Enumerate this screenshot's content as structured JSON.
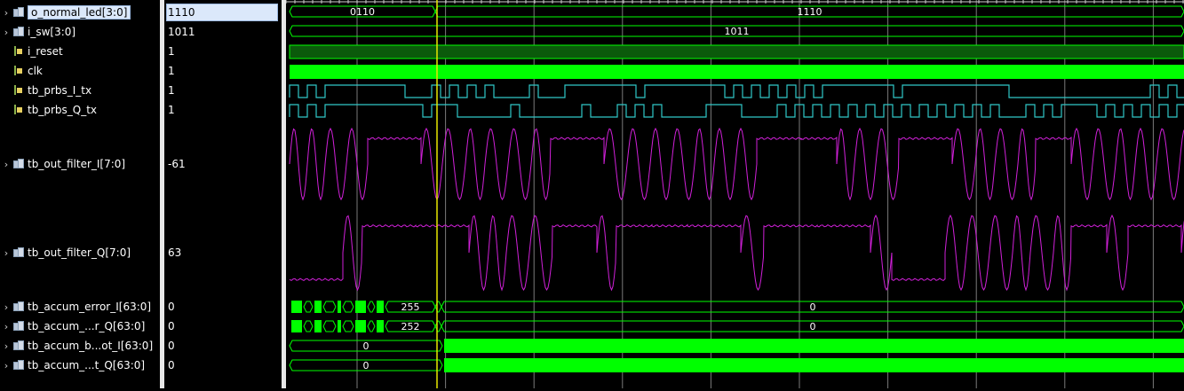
{
  "signals": [
    {
      "name": "o_normal_led[3:0]",
      "value": "1110",
      "type": "bus",
      "expandable": true,
      "selected": true
    },
    {
      "name": "i_sw[3:0]",
      "value": "1011",
      "type": "bus",
      "expandable": true
    },
    {
      "name": "i_reset",
      "value": "1",
      "type": "bit",
      "expandable": false
    },
    {
      "name": "clk",
      "value": "1",
      "type": "bit",
      "expandable": false
    },
    {
      "name": "tb_prbs_I_tx",
      "value": "1",
      "type": "bit",
      "expandable": false
    },
    {
      "name": "tb_prbs_Q_tx",
      "value": "1",
      "type": "bit",
      "expandable": false
    },
    {
      "name": "tb_out_filter_I[7:0]",
      "value": "-61",
      "type": "bus",
      "expandable": true
    },
    {
      "name": "tb_out_filter_Q[7:0]",
      "value": "63",
      "type": "bus",
      "expandable": true
    },
    {
      "name": "tb_accum_error_I[63:0]",
      "value": "0",
      "type": "bus",
      "expandable": true
    },
    {
      "name": "tb_accum_...r_Q[63:0]",
      "value": "0",
      "type": "bus",
      "expandable": true
    },
    {
      "name": "tb_accum_b...ot_I[63:0]",
      "value": "0",
      "type": "bus",
      "expandable": true
    },
    {
      "name": "tb_accum_...t_Q[63:0]",
      "value": "0",
      "type": "bus",
      "expandable": true
    }
  ],
  "waves": {
    "o_normal_led": {
      "left_label": "0110",
      "right_label": "1110"
    },
    "i_sw": {
      "label": "1011"
    },
    "accum_error_I": {
      "early_label": "255",
      "label": "0"
    },
    "accum_error_Q": {
      "early_label": "252",
      "label": "0"
    },
    "accum_bot_I": {
      "label": "0"
    },
    "accum_bot_Q": {
      "label": "0"
    }
  },
  "colors": {
    "bus": "#00ff00",
    "bit_fill": "#00ff00",
    "reset_fill": "#0b5a0b",
    "prbs": "#30c8c8",
    "analog": "#d020d8",
    "cursor": "#e8e800",
    "grid": "#7a7a7a"
  }
}
